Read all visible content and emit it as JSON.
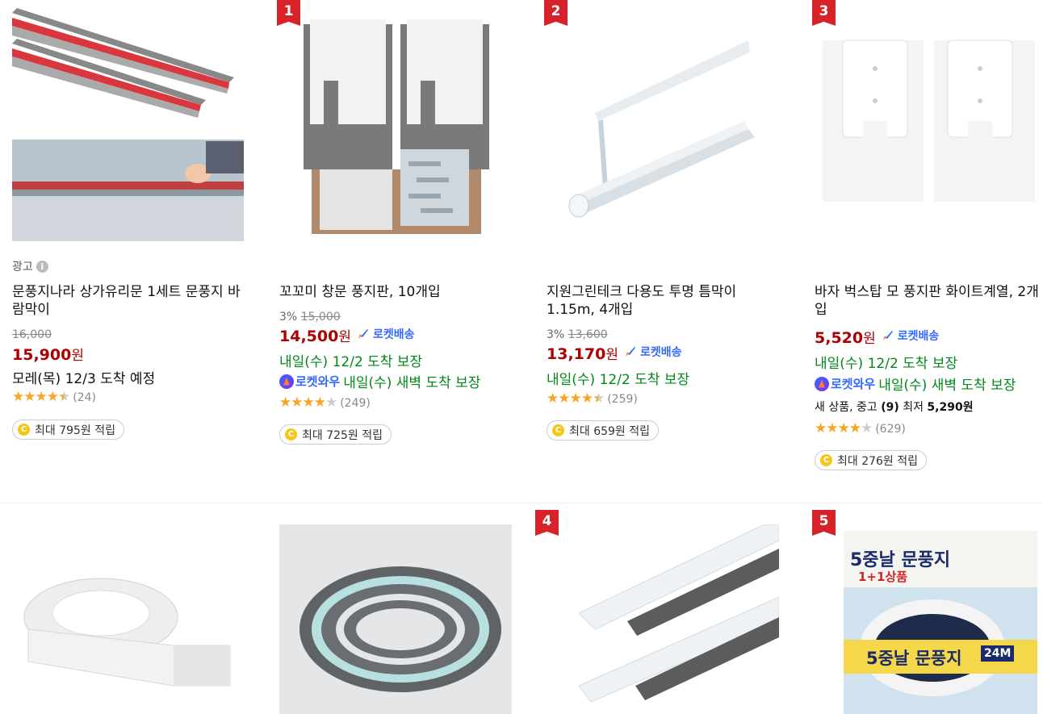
{
  "products_row1": [
    {
      "ad_label": "광고",
      "title": "문풍지나라 상가유리문 1세트 문풍지 바람막이",
      "original_price": "16,000",
      "price": "15,900",
      "won": "원",
      "delivery": "모레(목) 12/3 도착 예정",
      "rating_value": 4.5,
      "review_count": "(24)",
      "cash_label": "최대 795원 적립"
    },
    {
      "rank": "1",
      "discount": "3%",
      "original_price": "15,000",
      "title": "꼬꼬미 창문 풍지판, 10개입",
      "price": "14,500",
      "won": "원",
      "rocket_label": "로켓배송",
      "delivery": "내일(수) 12/2 도착 보장",
      "wow_label": "로켓와우",
      "wow_delivery": "내일(수) 새벽 도착 보장",
      "rating_value": 4.0,
      "review_count": "(249)",
      "cash_label": "최대 725원 적립"
    },
    {
      "rank": "2",
      "discount": "3%",
      "original_price": "13,600",
      "title": "지원그린테크 다용도 투명 틈막이 1.15m, 4개입",
      "price": "13,170",
      "won": "원",
      "rocket_label": "로켓배송",
      "delivery": "내일(수) 12/2 도착 보장",
      "rating_value": 4.5,
      "review_count": "(259)",
      "cash_label": "최대 659원 적립"
    },
    {
      "rank": "3",
      "title": "바자 벅스탑 모 풍지판 화이트계열, 2개입",
      "price": "5,520",
      "won": "원",
      "rocket_label": "로켓배송",
      "delivery": "내일(수) 12/2 도착 보장",
      "wow_label": "로켓와우",
      "wow_delivery": "내일(수) 새벽 도착 보장",
      "used_prefix": "새 상품, 중고 ",
      "used_count": "(9)",
      "used_mid": " 최저 ",
      "used_price": "5,290원",
      "rating_value": 4.0,
      "review_count": "(629)",
      "cash_label": "최대 276원 적립"
    }
  ],
  "products_row2": [
    {},
    {},
    {
      "rank": "4"
    },
    {
      "rank": "5",
      "package_text_top": "5중날 문풍지",
      "package_text_sub": "1+1상품",
      "package_text_band": "5중날 문풍지",
      "package_size": "24M"
    }
  ],
  "colors": {
    "price_red": "#ae0000",
    "rank_red": "#d8222a",
    "rocket_blue": "#346aff",
    "delivery_green": "#00891a",
    "star_orange": "#f5a623"
  }
}
